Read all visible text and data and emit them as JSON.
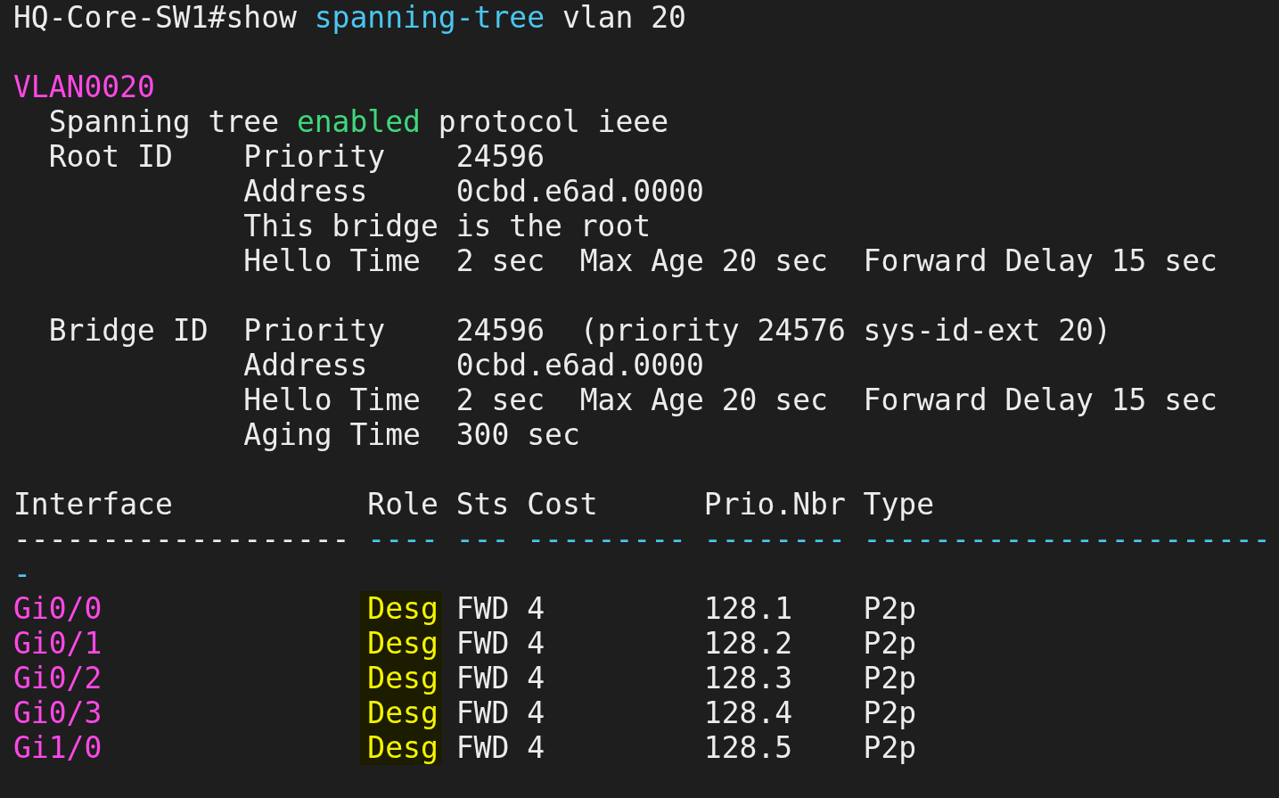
{
  "prompt": {
    "segments": [
      {
        "text": "HQ-Core-SW1#show",
        "color": "#ececec"
      },
      {
        "text": "spanning-tree",
        "color": "#4ac6f0"
      },
      {
        "text": "vlan 20",
        "color": "#ececec"
      }
    ]
  },
  "vlan": "VLAN0020",
  "status_line": {
    "segments": [
      {
        "text": "Spanning tree",
        "color": "#ececec"
      },
      {
        "text": "enabled",
        "color": "#3fd77c"
      },
      {
        "text": "protocol ieee",
        "color": "#ececec"
      }
    ]
  },
  "root_id": {
    "title": "Root ID",
    "fields": [
      {
        "kind": "values",
        "label": "Priority",
        "values": [
          "24596"
        ]
      },
      {
        "kind": "values",
        "label": "Address",
        "values": [
          "0cbd.e6ad.0000"
        ]
      },
      {
        "kind": "note",
        "text": "This bridge is the root"
      },
      {
        "kind": "values",
        "label": "Hello Time",
        "values": [
          "2 sec",
          "Max Age 20 sec",
          "Forward Delay 15 sec"
        ]
      }
    ]
  },
  "bridge_id": {
    "title": "Bridge ID",
    "fields": [
      {
        "kind": "values",
        "label": "Priority",
        "values": [
          "24596",
          "(priority 24576 sys-id-ext 20)"
        ]
      },
      {
        "kind": "values",
        "label": "Address",
        "values": [
          "0cbd.e6ad.0000"
        ]
      },
      {
        "kind": "values",
        "label": "Hello Time",
        "values": [
          "2 sec",
          "Max Age 20 sec",
          "Forward Delay 15 sec"
        ]
      },
      {
        "kind": "values",
        "label": "Aging Time",
        "values": [
          "300 sec"
        ]
      }
    ]
  },
  "table": {
    "columns": [
      {
        "label": "Interface",
        "rule": "-------------------",
        "color": "#ececec"
      },
      {
        "label": "Role",
        "rule": "----",
        "color": "#4ac6f0"
      },
      {
        "label": "Sts",
        "rule": "---",
        "color": "#4ac6f0"
      },
      {
        "label": "Cost",
        "rule": "---------",
        "color": "#4ac6f0"
      },
      {
        "label": "Prio.Nbr",
        "rule": "--------",
        "color": "#4ac6f0"
      },
      {
        "label": "Type",
        "rule": "-----------------------",
        "color": "#4ac6f0"
      }
    ],
    "rule_overflow": "-",
    "rows": [
      {
        "interface": "Gi0/0",
        "role": "Desg",
        "role_highlighted": true,
        "sts": "FWD",
        "cost": "4",
        "prio_nbr": "128.1",
        "type": "P2p"
      },
      {
        "interface": "Gi0/1",
        "role": "Desg",
        "role_highlighted": true,
        "sts": "FWD",
        "cost": "4",
        "prio_nbr": "128.2",
        "type": "P2p"
      },
      {
        "interface": "Gi0/2",
        "role": "Desg",
        "role_highlighted": true,
        "sts": "FWD",
        "cost": "4",
        "prio_nbr": "128.3",
        "type": "P2p"
      },
      {
        "interface": "Gi0/3",
        "role": "Desg",
        "role_highlighted": true,
        "sts": "FWD",
        "cost": "4",
        "prio_nbr": "128.4",
        "type": "P2p"
      },
      {
        "interface": "Gi1/0",
        "role": "Desg",
        "role_highlighted": true,
        "sts": "FWD",
        "cost": "4",
        "prio_nbr": "128.5",
        "type": "P2p"
      }
    ]
  }
}
